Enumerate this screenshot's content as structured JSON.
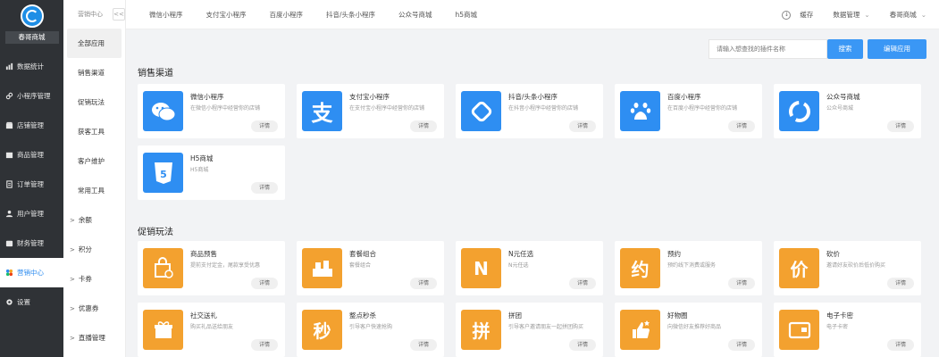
{
  "sidebar": {
    "store_name": "春哥商城",
    "items": [
      {
        "label": "数据统计",
        "icon": "chart-icon"
      },
      {
        "label": "小程序管理",
        "icon": "link-icon"
      },
      {
        "label": "店铺管理",
        "icon": "shop-icon"
      },
      {
        "label": "商品管理",
        "icon": "box-icon"
      },
      {
        "label": "订单管理",
        "icon": "order-icon"
      },
      {
        "label": "用户管理",
        "icon": "user-icon"
      },
      {
        "label": "财务管理",
        "icon": "wallet-icon"
      },
      {
        "label": "营销中心",
        "icon": "marketing-icon"
      },
      {
        "label": "设置",
        "icon": "gear-icon"
      }
    ]
  },
  "subbar": {
    "title": "营销中心",
    "collapse_label": "<<",
    "items": [
      {
        "label": "全部应用",
        "arrow": ""
      },
      {
        "label": "销售渠道",
        "arrow": ""
      },
      {
        "label": "促销玩法",
        "arrow": ""
      },
      {
        "label": "获客工具",
        "arrow": ""
      },
      {
        "label": "客户维护",
        "arrow": ""
      },
      {
        "label": "常用工具",
        "arrow": ""
      },
      {
        "label": "余额",
        "arrow": ">"
      },
      {
        "label": "积分",
        "arrow": ">"
      },
      {
        "label": "卡券",
        "arrow": ">"
      },
      {
        "label": "优惠券",
        "arrow": ">"
      },
      {
        "label": "直播管理",
        "arrow": ">"
      }
    ]
  },
  "topbar": {
    "tabs": [
      "微信小程序",
      "支付宝小程序",
      "百度小程序",
      "抖音/头条小程序",
      "公众号商城",
      "h5商城"
    ],
    "cache": "缓存",
    "data_mgmt": "数据管理",
    "store": "春哥商城"
  },
  "search": {
    "placeholder": "请输入想查找的插件名称",
    "search_label": "搜索",
    "edit_label": "编辑应用"
  },
  "sections": {
    "channels_title": "销售渠道",
    "promo_title": "促销玩法"
  },
  "detail_label": "详情",
  "channels": [
    {
      "name": "微信小程序",
      "desc": "在微信小程序中经营你的店铺",
      "icon": "wechat-icon"
    },
    {
      "name": "支付宝小程序",
      "desc": "在支付宝小程序中经营你的店铺",
      "icon": "alipay-icon"
    },
    {
      "name": "抖音/头条小程序",
      "desc": "在抖音小程序中经营你的店铺",
      "icon": "tiktok-icon"
    },
    {
      "name": "百度小程序",
      "desc": "在百度小程序中经营你的店铺",
      "icon": "baidu-icon"
    },
    {
      "name": "公众号商城",
      "desc": "公众号商城",
      "icon": "official-account-icon"
    },
    {
      "name": "H5商城",
      "desc": "H5商城",
      "icon": "html5-icon"
    }
  ],
  "promos": [
    {
      "name": "商品预售",
      "desc": "提前支付定金，尾款享受优惠",
      "icon": "presale-icon",
      "glyph": ""
    },
    {
      "name": "套餐组合",
      "desc": "套餐组合",
      "icon": "combo-icon",
      "glyph": ""
    },
    {
      "name": "N元任选",
      "desc": "N元任选",
      "icon": "n-choice-icon",
      "glyph": "N"
    },
    {
      "name": "预约",
      "desc": "预约线下消费或服务",
      "icon": "booking-icon",
      "glyph": "约"
    },
    {
      "name": "砍价",
      "desc": "邀请好友砍价后低价购买",
      "icon": "bargain-icon",
      "glyph": "价"
    },
    {
      "name": "社交送礼",
      "desc": "购买礼品送给朋友",
      "icon": "gift-icon",
      "glyph": ""
    },
    {
      "name": "整点秒杀",
      "desc": "引导客户快速抢购",
      "icon": "flash-sale-icon",
      "glyph": "秒"
    },
    {
      "name": "拼团",
      "desc": "引导客户邀请朋友一起拼团购买",
      "icon": "group-buy-icon",
      "glyph": "拼"
    },
    {
      "name": "好物圈",
      "desc": "向微信好友推荐好商品",
      "icon": "thumbs-up-icon",
      "glyph": ""
    },
    {
      "name": "电子卡密",
      "desc": "电子卡密",
      "icon": "card-icon",
      "glyph": ""
    }
  ],
  "colors": {
    "accent": "#3a97f5",
    "channel_icon": "#2e8ef2",
    "promo_icon": "#f3a12f",
    "sidebar_bg": "#2f3236"
  }
}
